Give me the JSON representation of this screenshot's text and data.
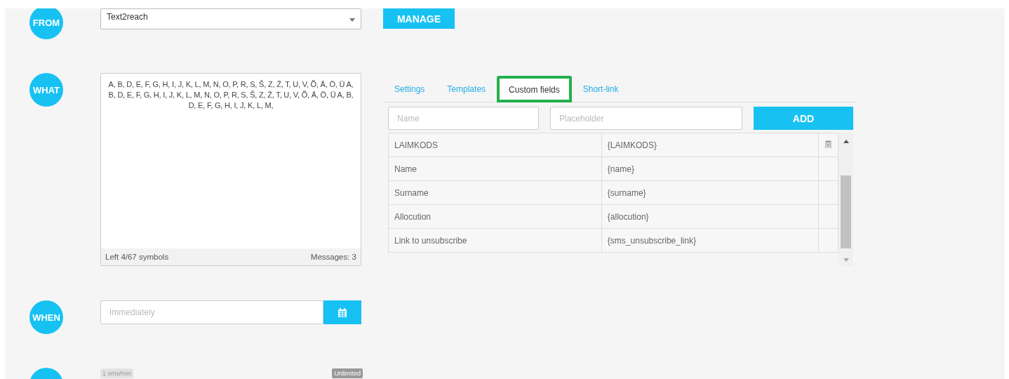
{
  "from": {
    "step": "FROM",
    "sender": "Text2reach",
    "manage_button": "MANAGE"
  },
  "what": {
    "step": "WHAT",
    "message": " A, B, D, E, F, G, H, I, J, K, L, M, N, O, P, R, S, Š, Z, Ž, T, U, V, Õ, Ä, Ö, Ü A, B, D, E, F, G, H, I, J, K, L, M, N, O, P, R, S, Š, Z, Ž, T, U, V, Õ, Ä, Ö, Ü A, B, D, E, F, G, H, I, J, K, L, M,",
    "left_symbols": "Left 4/67 symbols",
    "messages": "Messages: 3"
  },
  "tabs": [
    {
      "label": "Settings",
      "selected": false,
      "highlighted": false
    },
    {
      "label": "Templates",
      "selected": false,
      "highlighted": false
    },
    {
      "label": "Custom fields",
      "selected": true,
      "highlighted": true
    },
    {
      "label": "Short-link",
      "selected": false,
      "highlighted": false
    }
  ],
  "custom_fields": {
    "name_placeholder": "Name",
    "placeholder_placeholder": "Placeholder",
    "add_button": "ADD",
    "rows": [
      {
        "name": "LAIMKODS",
        "placeholder": "{LAIMKODS}",
        "deletable": true
      },
      {
        "name": "Name",
        "placeholder": "{name}",
        "deletable": false
      },
      {
        "name": "Surname",
        "placeholder": "{surname}",
        "deletable": false
      },
      {
        "name": "Allocution",
        "placeholder": "{allocution}",
        "deletable": false
      },
      {
        "name": "Link to unsubscribe",
        "placeholder": "{sms_unsubscribe_link}",
        "deletable": false
      }
    ]
  },
  "when": {
    "step": "WHEN",
    "placeholder": "Immediately"
  },
  "speed": {
    "min_label": "1 sms/min",
    "max_label": "Unlimited"
  }
}
